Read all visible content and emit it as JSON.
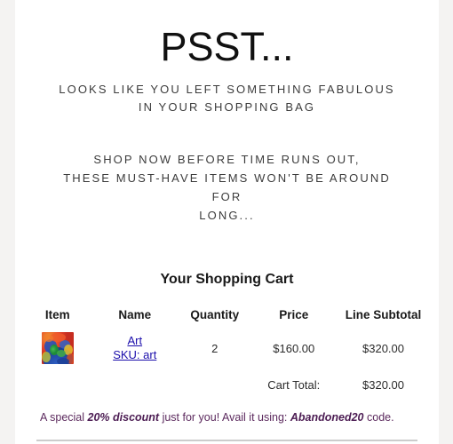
{
  "hero": {
    "title": "PSST...",
    "subtitle_line1": "LOOKS LIKE YOU LEFT SOMETHING FABULOUS",
    "subtitle_line2": "IN YOUR SHOPPING BAG"
  },
  "promo": {
    "line1": "SHOP NOW BEFORE TIME RUNS OUT,",
    "line2": "THESE MUST-HAVE ITEMS WON'T BE AROUND FOR",
    "line3": "LONG..."
  },
  "cart": {
    "heading": "Your Shopping Cart",
    "columns": [
      "Item",
      "Name",
      "Quantity",
      "Price",
      "Line Subtotal"
    ],
    "rows": [
      {
        "thumbnail_alt": "product-thumbnail",
        "name": "Art",
        "sku": "SKU: art",
        "quantity": "2",
        "price": "$160.00",
        "line_subtotal": "$320.00"
      }
    ],
    "total_label": "Cart Total:",
    "total_value": "$320.00"
  },
  "discount": {
    "prefix": "A special ",
    "emphasis": "20% discount",
    "middle": " just for you! Avail it using: ",
    "code": "Abandoned20",
    "suffix": " code."
  },
  "colors": {
    "page_background": "#f4f3f2",
    "content_background": "#ffffff",
    "heading_text": "#111111",
    "body_text": "#3c3c3c",
    "link": "#1a0dab",
    "discount_text": "#5c2a5e",
    "divider": "#cccccc"
  }
}
